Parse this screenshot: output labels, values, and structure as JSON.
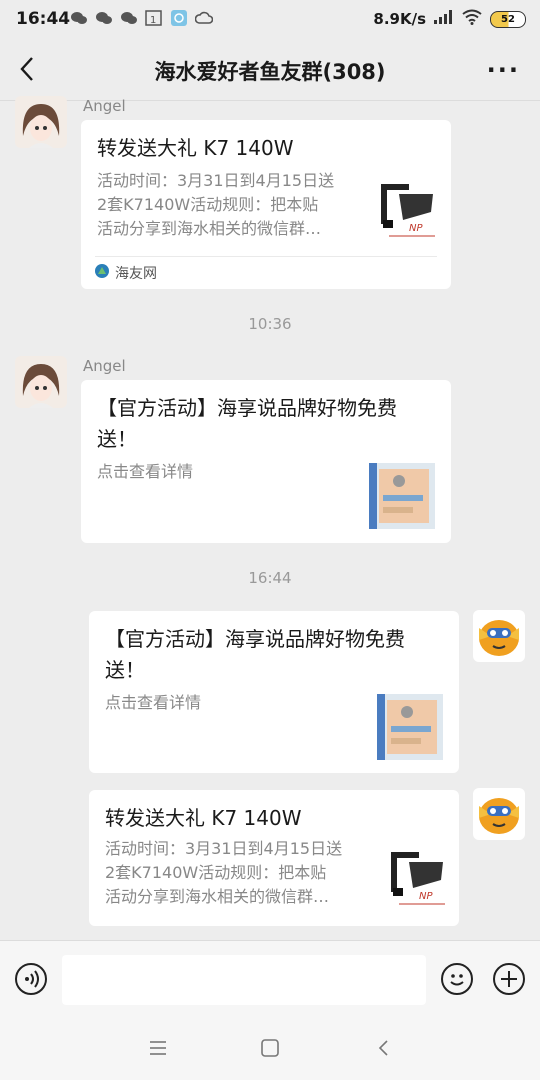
{
  "status_bar": {
    "time": "16:44",
    "network_speed": "8.9K/s",
    "battery": "52"
  },
  "header": {
    "title": "海水爱好者鱼友群(308)",
    "more": "···"
  },
  "messages": [
    {
      "sender": "Angel",
      "title": "转发送大礼 K7 140W",
      "desc": [
        "活动时间：3月31日到4月15日送",
        "2套K7140W活动规则：把本贴",
        "活动分享到海水相关的微信群…"
      ],
      "source": "海友网"
    },
    {
      "time": "10:36"
    },
    {
      "sender": "Angel",
      "title": [
        "【官方活动】海享说品牌好物免费",
        "送！"
      ],
      "desc": [
        "点击查看详情"
      ]
    },
    {
      "time": "16:44"
    },
    {
      "title": [
        "【官方活动】海享说品牌好物免费",
        "送！"
      ],
      "desc": [
        "点击查看详情"
      ]
    },
    {
      "title": "转发送大礼 K7 140W",
      "desc": [
        "活动时间：3月31日到4月15日送",
        "2套K7140W活动规则：把本贴",
        "活动分享到海水相关的微信群…"
      ]
    }
  ],
  "colors": {
    "background": "#ededed",
    "bubble": "#ffffff",
    "accent_battery": "#f2c94c"
  },
  "icons": [
    "back-arrow-icon",
    "more-icon",
    "voice-icon",
    "emoji-icon",
    "plus-icon",
    "menu-icon",
    "home-icon",
    "back-nav-icon"
  ]
}
